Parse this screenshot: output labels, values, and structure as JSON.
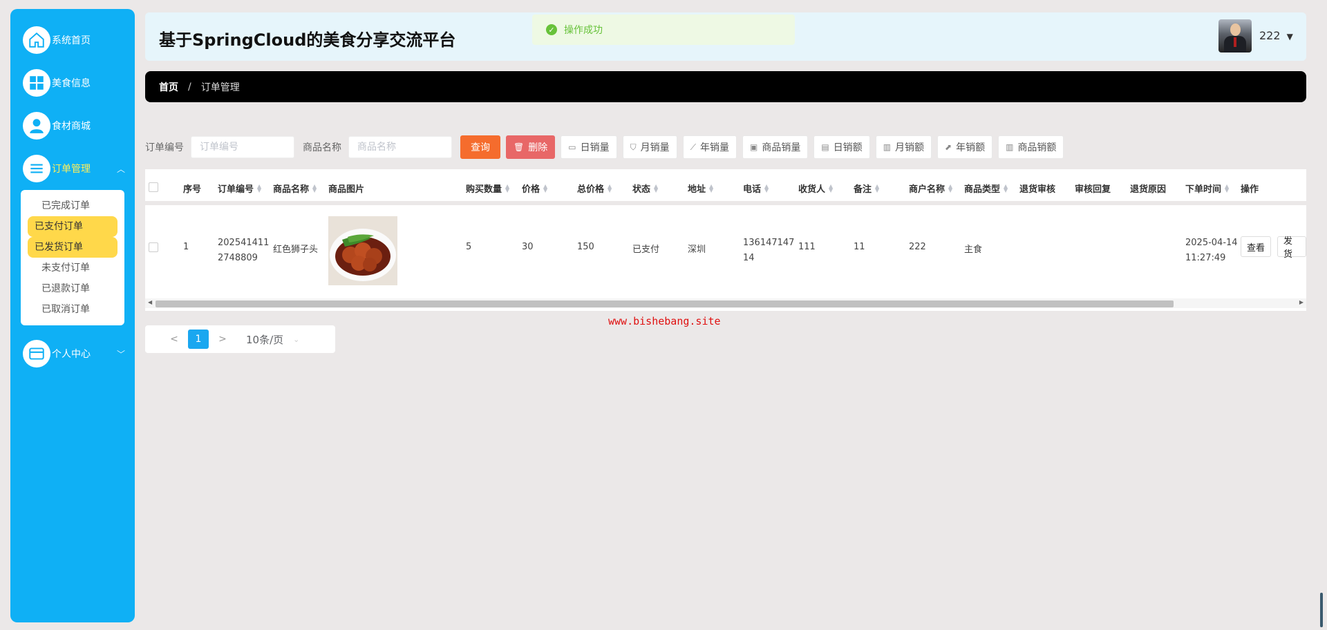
{
  "app": {
    "title": "基于SpringCloud的美食分享交流平台"
  },
  "toast": {
    "text": "操作成功"
  },
  "user": {
    "name": "222"
  },
  "sidebar": {
    "items": [
      {
        "label": "系统首页",
        "icon": "home-icon"
      },
      {
        "label": "美食信息",
        "icon": "grid-icon"
      },
      {
        "label": "食材商城",
        "icon": "user-icon"
      },
      {
        "label": "订单管理",
        "icon": "list-icon"
      },
      {
        "label": "个人中心",
        "icon": "card-icon"
      }
    ],
    "submenu": [
      "已完成订单",
      "已支付订单",
      "已发货订单",
      "未支付订单",
      "已退款订单",
      "已取消订单"
    ]
  },
  "breadcrumb": {
    "home": "首页",
    "sep": "/",
    "current": "订单管理"
  },
  "search": {
    "order_label": "订单编号",
    "order_placeholder": "订单编号",
    "goods_label": "商品名称",
    "goods_placeholder": "商品名称",
    "query": "查询",
    "delete": "删除",
    "buttons": [
      "日销量",
      "月销量",
      "年销量",
      "商品销量",
      "日销额",
      "月销额",
      "年销额",
      "商品销额"
    ]
  },
  "table": {
    "columns": [
      "序号",
      "订单编号",
      "商品名称",
      "商品图片",
      "购买数量",
      "价格",
      "总价格",
      "状态",
      "地址",
      "电话",
      "收货人",
      "备注",
      "商户名称",
      "商品类型",
      "退货审核",
      "审核回复",
      "退货原因",
      "下单时间",
      "操作"
    ],
    "rows": [
      {
        "index": "1",
        "order_no_1": "202541411",
        "order_no_2": "2748809",
        "goods_name": "红色狮子头",
        "quantity": "5",
        "price": "30",
        "total": "150",
        "status": "已支付",
        "address": "深圳",
        "phone_1": "136147147",
        "phone_2": "14",
        "receiver": "111",
        "note": "11",
        "merchant": "222",
        "goods_type": "主食",
        "time_1": "2025-04-14",
        "time_2": "11:27:49",
        "view": "查看",
        "ship": "发货"
      }
    ]
  },
  "watermark": "www.bishebang.site",
  "pagination": {
    "current": "1",
    "size": "10条/页",
    "prev": "<",
    "next": ">"
  }
}
